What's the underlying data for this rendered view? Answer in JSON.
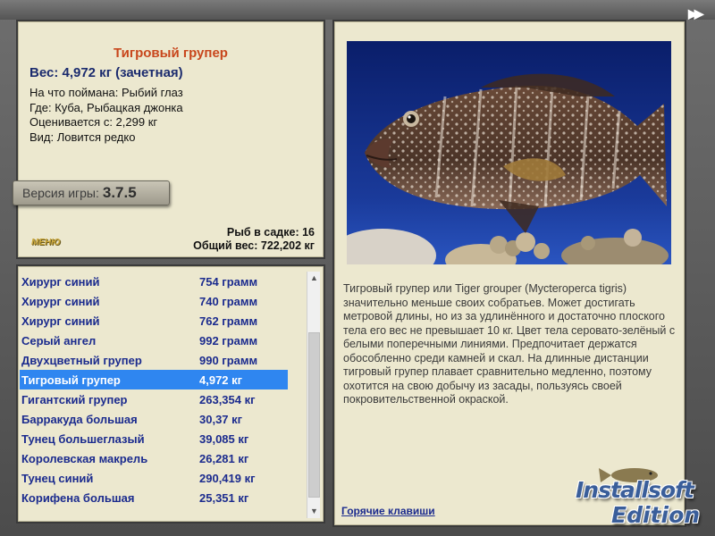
{
  "nav": {
    "next_icon": "fast-forward-icon",
    "next_glyph": "▶▶"
  },
  "fish": {
    "name": "Тигровый групер",
    "weight_line": "Вес: 4,972 кг (зачетная)",
    "details": [
      "На что поймана: Рыбий глаз",
      "Где: Куба, Рыбацкая джонка",
      "Оценивается с: 2,299 кг",
      "Вид: Ловится редко"
    ]
  },
  "version": {
    "label": "Версия игры:",
    "number": "3.7.5"
  },
  "menu": {
    "label": "МЕНЮ"
  },
  "stats": {
    "in_cage": "Рыб в садке: 16",
    "total_weight": "Общий вес: 722,202 кг"
  },
  "catch_list": [
    {
      "name": "Хирург синий",
      "weight": "754 грамм",
      "selected": false
    },
    {
      "name": "Хирург синий",
      "weight": "740 грамм",
      "selected": false
    },
    {
      "name": "Хирург синий",
      "weight": "762 грамм",
      "selected": false
    },
    {
      "name": "Серый ангел",
      "weight": "992 грамм",
      "selected": false
    },
    {
      "name": "Двухцветный групер",
      "weight": "990 грамм",
      "selected": false
    },
    {
      "name": "Тигровый групер",
      "weight": "4,972 кг",
      "selected": true
    },
    {
      "name": "Гигантский групер",
      "weight": "263,354 кг",
      "selected": false
    },
    {
      "name": "Барракуда большая",
      "weight": "30,37 кг",
      "selected": false
    },
    {
      "name": "Тунец большеглазый",
      "weight": "39,085 кг",
      "selected": false
    },
    {
      "name": "Королевская макрель",
      "weight": "26,281 кг",
      "selected": false
    },
    {
      "name": "Тунец синий",
      "weight": "290,419 кг",
      "selected": false
    },
    {
      "name": "Корифена большая",
      "weight": "25,351 кг",
      "selected": false
    }
  ],
  "description": {
    "text": "Тигровый групер или Tiger grouper (Mycteroperca tigris) значительно меньше своих собратьев. Может достигать метровой длины, но из за удлинённого и достаточно плоского тела его вес не превышает 10 кг. Цвет тела серовато-зелёный с белыми поперечными линиями. Предпочитает держатся обособленно среди камней и скал. На длинные дистанции тигровый групер плавает сравнительно медленно, поэтому охотится на свою добычу из засады, пользуясь своей покровительственной окраской.",
    "hotkeys_link": "Горячие клавиши"
  },
  "watermark": {
    "line1": "Installsoft",
    "line2": "Edition"
  },
  "colors": {
    "panel_bg": "#ece8cf",
    "fish_name": "#c8461c",
    "list_text": "#1b2b8e",
    "selection": "#2f86f0"
  }
}
